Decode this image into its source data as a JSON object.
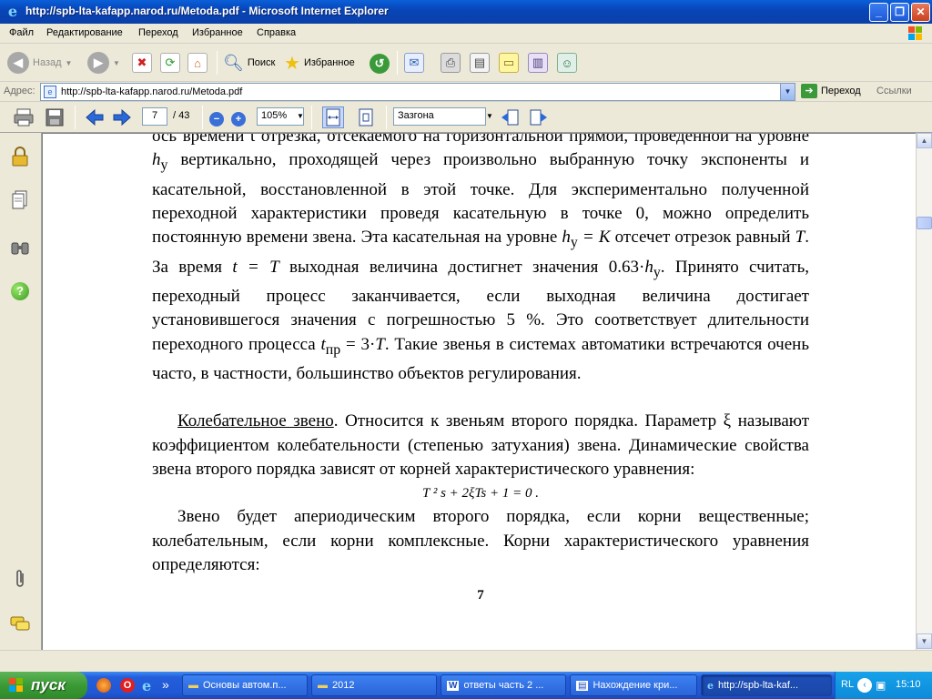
{
  "window": {
    "title": "http://spb-lta-kafapp.narod.ru/Metoda.pdf - Microsoft Internet Explorer"
  },
  "menu": [
    "Файл",
    "Редактирование",
    "Переход",
    "Избранное",
    "Справка"
  ],
  "toolbar": {
    "back_label": "Назад",
    "search_label": "Поиск",
    "favorites_label": "Избранное"
  },
  "address": {
    "label": "Адрес:",
    "url": "http://spb-lta-kafapp.narod.ru/Metoda.pdf",
    "go_label": "Переход",
    "links_label": "Ссылки"
  },
  "pdf": {
    "page_current": "7",
    "page_total": "/ 43",
    "zoom": "105%",
    "find_value": "Зазгона"
  },
  "document": {
    "para1_line1": "ось времени t отрезка, отсекаемого на горизонтальной прямой,",
    "para1_rest_a": "проведенной на уровне ",
    "h": "h",
    "sub_y": "у",
    "para1_rest_b": " вертикально, проходящей через произвольно выбранную точку экспоненты и касательной, восстановленной в этой точке. Для экспериментально полученной переходной характеристики проведя касательную в точке 0, можно определить постоянную времени звена. Эта касательная на уровне ",
    "eq_K": " = K",
    "para1_rest_c": " отсечет отрезок равный ",
    "T": "T",
    "para1_rest_d": ". За время ",
    "t": "t",
    "eq_T": " = T",
    "para1_rest_e": " выходная величина достигнет значения 0.63·",
    "para1_rest_f": ". Принято считать, переходный процесс заканчивается, если выходная величина достигает установившегося значения с погрешностью 5 %. Это соответствует длительности переходного процесса ",
    "sub_pr": "пр",
    "eq_3T": " = 3·",
    "para1_rest_g": ". Такие звенья в системах автоматики встречаются очень часто, в частности, большинство объектов регулирования.",
    "para2_title": "Колебательное звено",
    "para2_text": ". Относится к звеньям второго порядка. Параметр ξ называют коэффициентом колебательности (степенью затухания) звена. Динамические свойства звена второго порядка зависят от корней характеристического уравнения:",
    "formula": "T ² s + 2ξTs + 1 = 0 .",
    "para3": "Звено будет апериодическим второго порядка, если корни вещественные; колебательным, если корни комплексные. Корни характеристического уравнения определяются:",
    "page_number": "7"
  },
  "taskbar": {
    "start_label": "пуск",
    "items": [
      "Основы автом.п...",
      "2012",
      "ответы часть 2 ...",
      "Нахождение кри...",
      "http://spb-lta-kaf..."
    ],
    "lang": "RL",
    "clock": "15:10"
  }
}
